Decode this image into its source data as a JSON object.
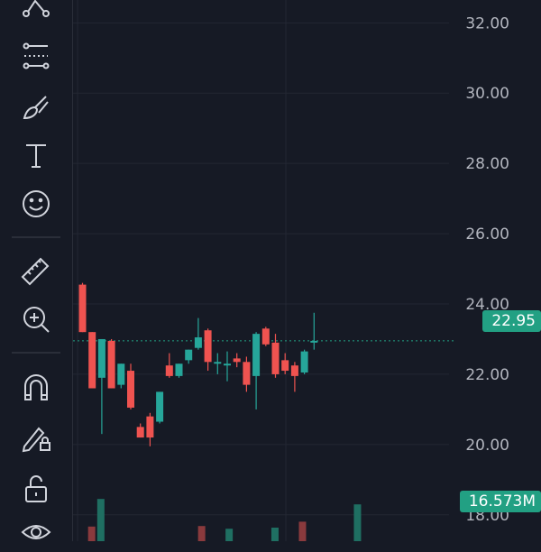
{
  "toolbar": {
    "tools": [
      {
        "name": "pattern-tool-icon"
      },
      {
        "name": "fib-tool-icon"
      },
      {
        "name": "brush-tool-icon"
      },
      {
        "name": "text-tool-icon"
      },
      {
        "name": "emoji-tool-icon"
      },
      {
        "name": "ruler-tool-icon"
      },
      {
        "name": "zoom-in-tool-icon"
      },
      {
        "name": "magnet-tool-icon"
      },
      {
        "name": "lock-drawing-tool-icon"
      },
      {
        "name": "unlock-tool-icon"
      },
      {
        "name": "eye-tool-icon"
      }
    ]
  },
  "colors": {
    "background": "#161a25",
    "grid": "#232733",
    "axis_text": "#b2b5be",
    "up": "#26a69a",
    "down": "#ef5350",
    "price_line": "#22a083",
    "volume_up": "#1f6f62",
    "volume_down": "#8a3a3d"
  },
  "last_price_label": "22.95",
  "volume_label": "16.573M",
  "chart_data": {
    "type": "candlestick",
    "y_axis": {
      "ticks": [
        "32.00",
        "30.00",
        "28.00",
        "26.00",
        "24.00",
        "22.00",
        "20.00",
        "18.00"
      ],
      "ylim": [
        17.25,
        32.65
      ]
    },
    "last_price": 22.95,
    "candles": [
      {
        "open": 24.55,
        "high": 24.6,
        "low": 23.2,
        "close": 23.2
      },
      {
        "open": 23.2,
        "high": 23.2,
        "low": 21.6,
        "close": 21.6
      },
      {
        "open": 21.9,
        "high": 23.0,
        "low": 20.3,
        "close": 23.0
      },
      {
        "open": 22.95,
        "high": 23.0,
        "low": 21.6,
        "close": 21.6
      },
      {
        "open": 21.7,
        "high": 22.3,
        "low": 21.6,
        "close": 22.3
      },
      {
        "open": 22.1,
        "high": 22.3,
        "low": 21.0,
        "close": 21.05
      },
      {
        "open": 20.5,
        "high": 20.6,
        "low": 20.2,
        "close": 20.2
      },
      {
        "open": 20.8,
        "high": 20.9,
        "low": 19.95,
        "close": 20.2
      },
      {
        "open": 20.65,
        "high": 21.5,
        "low": 20.6,
        "close": 21.5
      },
      {
        "open": 22.25,
        "high": 22.6,
        "low": 21.9,
        "close": 21.95
      },
      {
        "open": 21.95,
        "high": 22.3,
        "low": 21.9,
        "close": 22.3
      },
      {
        "open": 22.4,
        "high": 22.7,
        "low": 22.3,
        "close": 22.7
      },
      {
        "open": 22.75,
        "high": 23.6,
        "low": 22.7,
        "close": 23.05
      },
      {
        "open": 23.25,
        "high": 23.3,
        "low": 22.1,
        "close": 22.35
      },
      {
        "open": 22.3,
        "high": 22.6,
        "low": 22.0,
        "close": 22.35
      },
      {
        "open": 22.25,
        "high": 22.65,
        "low": 21.8,
        "close": 22.3
      },
      {
        "open": 22.45,
        "high": 22.6,
        "low": 22.2,
        "close": 22.35
      },
      {
        "open": 22.35,
        "high": 22.5,
        "low": 21.5,
        "close": 21.7
      },
      {
        "open": 21.95,
        "high": 23.2,
        "low": 21.0,
        "close": 23.15
      },
      {
        "open": 23.3,
        "high": 23.35,
        "low": 22.8,
        "close": 22.85
      },
      {
        "open": 22.9,
        "high": 23.15,
        "low": 21.9,
        "close": 22.0
      },
      {
        "open": 22.4,
        "high": 22.6,
        "low": 22.0,
        "close": 22.1
      },
      {
        "open": 22.25,
        "high": 22.35,
        "low": 21.5,
        "close": 21.95
      },
      {
        "open": 22.05,
        "high": 22.7,
        "low": 22.0,
        "close": 22.65
      },
      {
        "open": 22.9,
        "high": 23.75,
        "low": 22.7,
        "close": 22.95
      }
    ],
    "volume_bars": [
      {
        "index": 2,
        "direction": "up",
        "relative": 0.78
      },
      {
        "index": 1,
        "direction": "down",
        "relative": 0.27
      },
      {
        "index": 13,
        "direction": "down",
        "relative": 0.28
      },
      {
        "index": 16,
        "direction": "up",
        "relative": 0.23
      },
      {
        "index": 21,
        "direction": "up",
        "relative": 0.25
      },
      {
        "index": 24,
        "direction": "down",
        "relative": 0.36
      },
      {
        "index": 30,
        "direction": "up",
        "relative": 0.68
      }
    ]
  }
}
